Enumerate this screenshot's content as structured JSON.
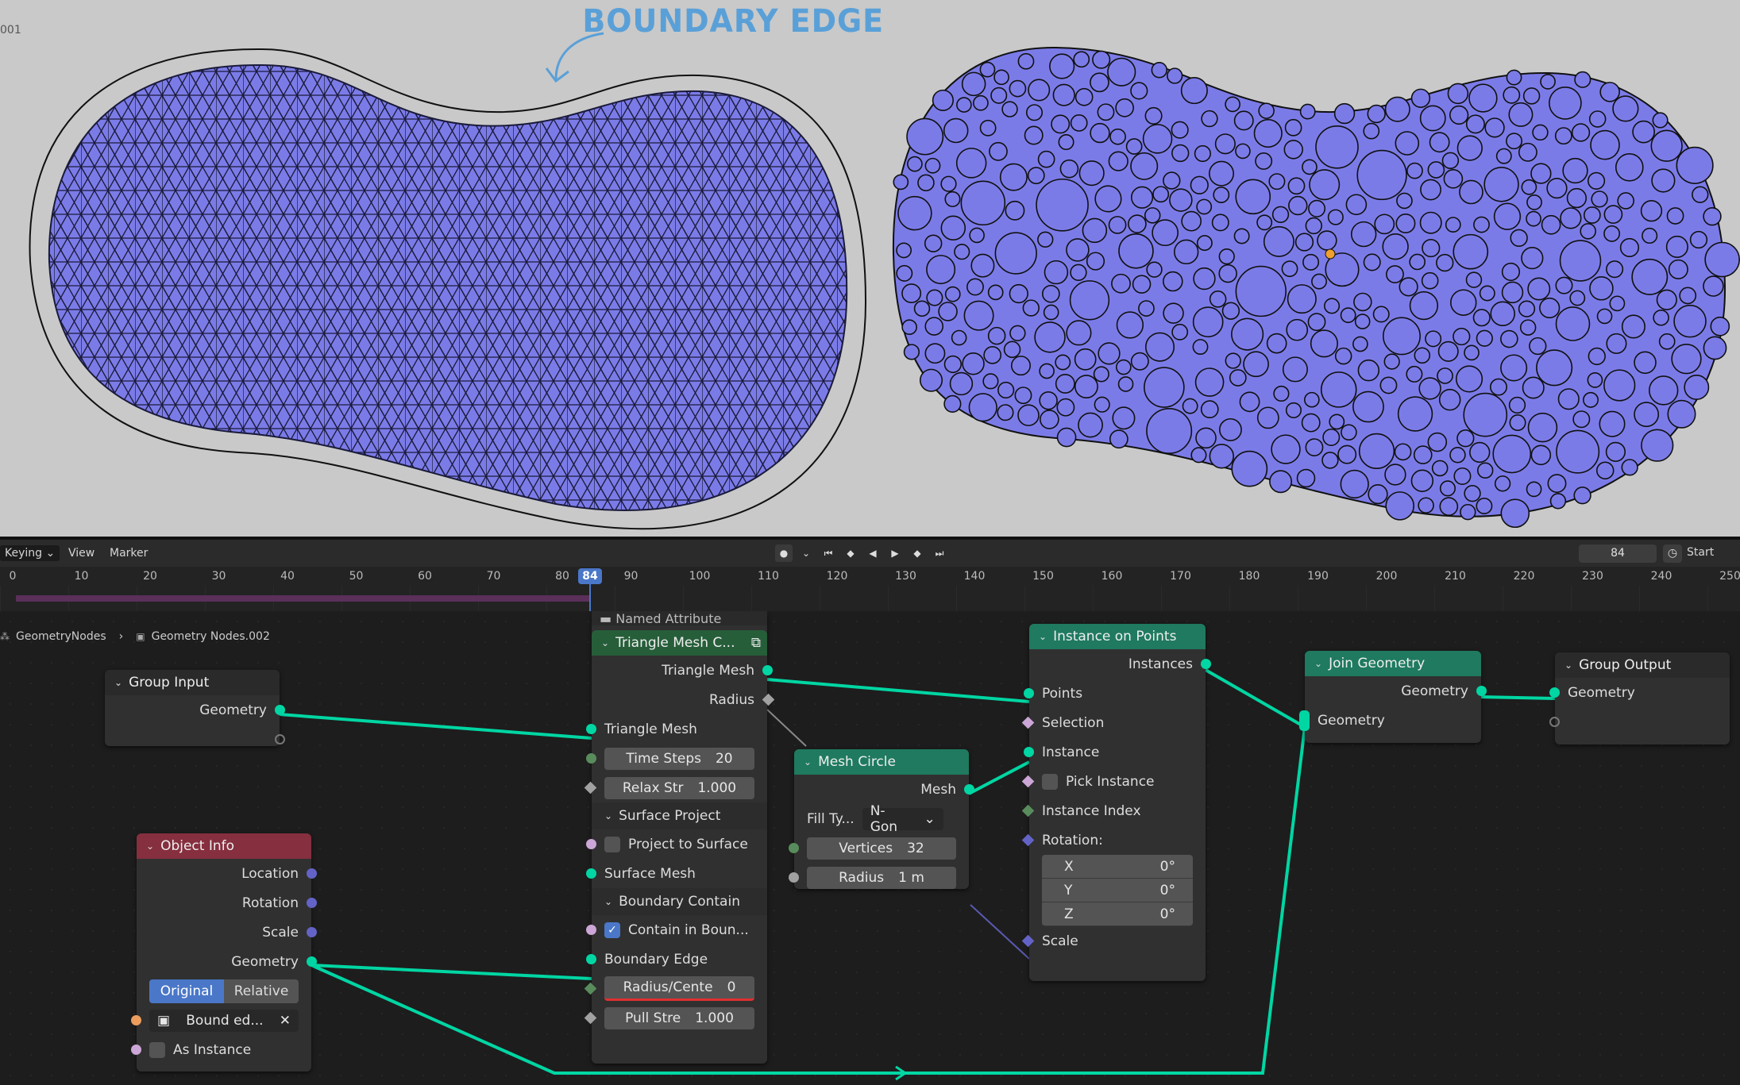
{
  "viewport": {
    "corner_label": "001",
    "annotation": "BOUNDARY EDGE",
    "mesh_fill": "#7b7be8"
  },
  "timeline": {
    "menus": [
      "Keying",
      "View",
      "Marker"
    ],
    "current_frame": "84",
    "start_label": "Start",
    "ticks": [
      "0",
      "10",
      "20",
      "30",
      "40",
      "50",
      "60",
      "70",
      "80",
      "90",
      "100",
      "110",
      "120",
      "130",
      "140",
      "150",
      "160",
      "170",
      "180",
      "190",
      "200",
      "210",
      "220",
      "230",
      "240",
      "250"
    ]
  },
  "breadcrumb": {
    "tree": "GeometryNodes",
    "group": "Geometry Nodes.002"
  },
  "nodes": {
    "group_input": {
      "title": "Group Input",
      "geometry": "Geometry"
    },
    "object_info": {
      "title": "Object Info",
      "location": "Location",
      "rotation": "Rotation",
      "scale": "Scale",
      "geometry": "Geometry",
      "mode_original": "Original",
      "mode_relative": "Relative",
      "object": "Bound ed...",
      "as_instance": "As Instance"
    },
    "named_attr": {
      "title": "Named Attribute"
    },
    "triangle_mesh": {
      "title": "Triangle Mesh C...",
      "out_mesh": "Triangle Mesh",
      "out_radius": "Radius",
      "in_mesh": "Triangle Mesh",
      "time_steps_label": "Time Steps",
      "time_steps_val": "20",
      "relax_label": "Relax Str",
      "relax_val": "1.000",
      "surface_panel": "Surface Project",
      "project_label": "Project to Surface",
      "surface_mesh": "Surface Mesh",
      "boundary_panel": "Boundary Contain",
      "contain_label": "Contain in Boun...",
      "boundary_edge": "Boundary Edge",
      "radius_center_label": "Radius/Cente",
      "radius_center_val": "0",
      "pull_label": "Pull Stre",
      "pull_val": "1.000"
    },
    "mesh_circle": {
      "title": "Mesh Circle",
      "mesh": "Mesh",
      "fill_label": "Fill Ty...",
      "fill_value": "N-Gon",
      "vertices_label": "Vertices",
      "vertices_val": "32",
      "radius_label": "Radius",
      "radius_val": "1 m"
    },
    "instance_on_points": {
      "title": "Instance on Points",
      "instances": "Instances",
      "points": "Points",
      "selection": "Selection",
      "instance": "Instance",
      "pick_instance": "Pick Instance",
      "instance_index": "Instance Index",
      "rotation": "Rotation:",
      "x_label": "X",
      "x_val": "0°",
      "y_label": "Y",
      "y_val": "0°",
      "z_label": "Z",
      "z_val": "0°",
      "scale": "Scale"
    },
    "join_geometry": {
      "title": "Join Geometry",
      "out": "Geometry",
      "in": "Geometry"
    },
    "group_output": {
      "title": "Group Output",
      "geometry": "Geometry"
    }
  },
  "colors": {
    "geometry_link": "#00d6a3",
    "frame_accent": "#4a77c8"
  }
}
